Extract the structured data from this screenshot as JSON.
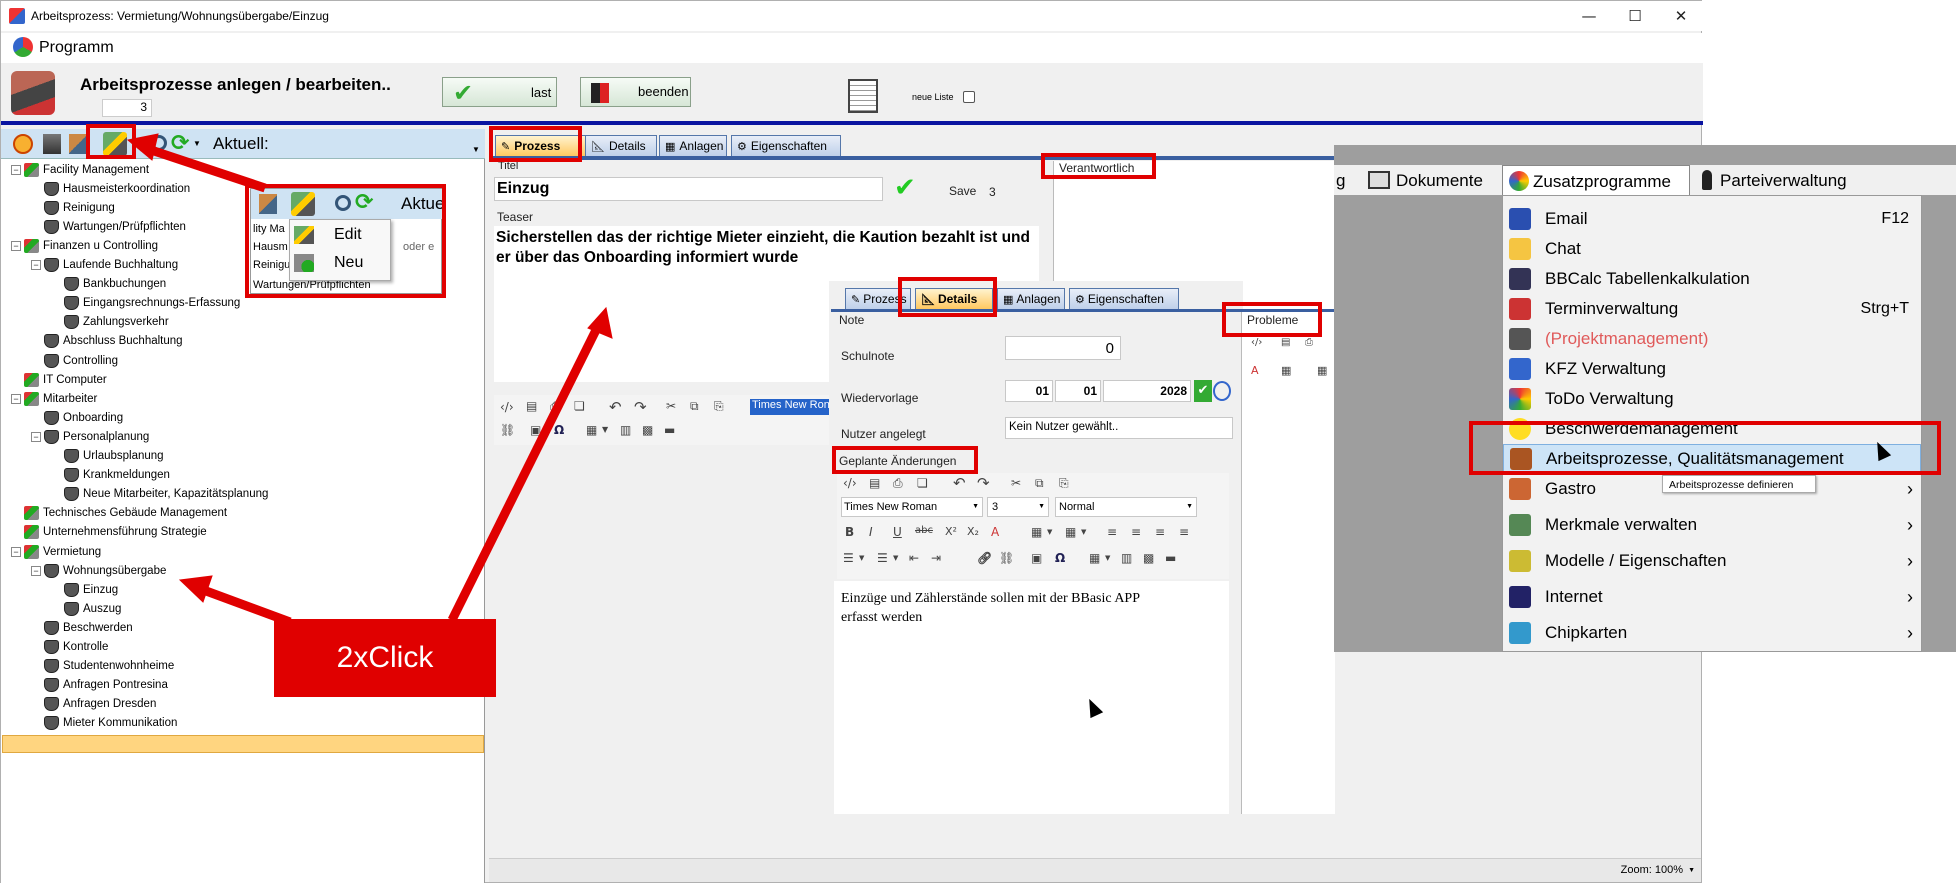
{
  "window": {
    "title": "Arbeitsprozess: Vermietung/Wohnungsübergabe/Einzug",
    "menu_program": "Programm",
    "controls": {
      "minimize": "—",
      "maximize": "☐",
      "close": "✕"
    }
  },
  "header": {
    "heading": "Arbeitsprozesse anlegen / bearbeiten..",
    "count": "3",
    "last_button": "last",
    "end_button": "beenden",
    "new_list_label": "neue Liste"
  },
  "left_toolbar": {
    "aktuell_label": "Aktuell:"
  },
  "popup": {
    "aktuell_label": "Aktue",
    "menu_items": [
      "Edit",
      "Neu"
    ],
    "bg_rows": [
      "lity Ma",
      "Hausm",
      "Reinigu",
      "Wartungen/Prüfpflichten"
    ],
    "bg_input": "oder e"
  },
  "tree": {
    "items": [
      {
        "label": "Facility Management",
        "indent": 0,
        "kind": "folder",
        "expander": "−"
      },
      {
        "label": "Hausmeisterkoordination",
        "indent": 1,
        "kind": "shield",
        "expander": ""
      },
      {
        "label": "Reinigung",
        "indent": 1,
        "kind": "shield",
        "expander": ""
      },
      {
        "label": "Wartungen/Prüfpflichten",
        "indent": 1,
        "kind": "shield",
        "expander": ""
      },
      {
        "label": "Finanzen u Controlling",
        "indent": 0,
        "kind": "folder",
        "expander": "−"
      },
      {
        "label": "Laufende Buchhaltung",
        "indent": 1,
        "kind": "shield",
        "expander": "−"
      },
      {
        "label": "Bankbuchungen",
        "indent": 2,
        "kind": "shield",
        "expander": ""
      },
      {
        "label": "Eingangsrechnungs-Erfassung",
        "indent": 2,
        "kind": "shield",
        "expander": ""
      },
      {
        "label": "Zahlungsverkehr",
        "indent": 2,
        "kind": "shield",
        "expander": ""
      },
      {
        "label": "Abschluss Buchhaltung",
        "indent": 1,
        "kind": "shield",
        "expander": ""
      },
      {
        "label": "Controlling",
        "indent": 1,
        "kind": "shield",
        "expander": ""
      },
      {
        "label": "IT Computer",
        "indent": 0,
        "kind": "folder",
        "expander": ""
      },
      {
        "label": "Mitarbeiter",
        "indent": 0,
        "kind": "folder",
        "expander": "−"
      },
      {
        "label": "Onboarding",
        "indent": 1,
        "kind": "shield",
        "expander": ""
      },
      {
        "label": "Personalplanung",
        "indent": 1,
        "kind": "shield",
        "expander": "−"
      },
      {
        "label": "Urlaubsplanung",
        "indent": 2,
        "kind": "shield",
        "expander": ""
      },
      {
        "label": "Krankmeldungen",
        "indent": 2,
        "kind": "shield",
        "expander": ""
      },
      {
        "label": "Neue Mitarbeiter, Kapazitätsplanung",
        "indent": 2,
        "kind": "shield",
        "expander": ""
      },
      {
        "label": "Technisches Gebäude Management",
        "indent": 0,
        "kind": "folder",
        "expander": ""
      },
      {
        "label": "Unternehmensführung Strategie",
        "indent": 0,
        "kind": "folder",
        "expander": ""
      },
      {
        "label": "Vermietung",
        "indent": 0,
        "kind": "folder",
        "expander": "−"
      },
      {
        "label": "Wohnungsübergabe",
        "indent": 1,
        "kind": "shield",
        "expander": "−"
      },
      {
        "label": "Einzug",
        "indent": 2,
        "kind": "shield",
        "expander": ""
      },
      {
        "label": "Auszug",
        "indent": 2,
        "kind": "shield",
        "expander": ""
      },
      {
        "label": "Beschwerden",
        "indent": 1,
        "kind": "shield",
        "expander": ""
      },
      {
        "label": "Kontrolle",
        "indent": 1,
        "kind": "shield",
        "expander": ""
      },
      {
        "label": "Studentenwohnheime",
        "indent": 1,
        "kind": "shield",
        "expander": ""
      },
      {
        "label": "Anfragen Pontresina",
        "indent": 1,
        "kind": "shield",
        "expander": ""
      },
      {
        "label": "Anfragen Dresden",
        "indent": 1,
        "kind": "shield",
        "expander": ""
      },
      {
        "label": "Mieter Kommunikation",
        "indent": 1,
        "kind": "shield",
        "expander": ""
      }
    ]
  },
  "callout": {
    "text": "2xClick"
  },
  "main_tabs": [
    "Prozess",
    "Details",
    "Anlagen",
    "Eigenschaften"
  ],
  "prozess": {
    "title_label": "Titel",
    "title_value": "Einzug",
    "save_label": "Save",
    "save_count": "3",
    "teaser_label": "Teaser",
    "teaser_value": "Sicherstellen das der richtige Mieter einzieht, die Kaution bezahlt ist und er über das Onboarding informiert wurde",
    "verantwortlich_label": "Verantwortlich",
    "font_value": "Times New Ron"
  },
  "details": {
    "tabs": [
      "Prozess",
      "Details",
      "Anlagen",
      "Eigenschaften"
    ],
    "note_label": "Note",
    "probleme_label": "Probleme",
    "schulnote_label": "Schulnote",
    "schulnote_value": "0",
    "wiedervorlage_label": "Wiedervorlage",
    "date_day": "01",
    "date_month": "01",
    "date_year": "2028",
    "nutzer_label": "Nutzer angelegt",
    "nutzer_value": "Kein Nutzer gewählt..",
    "geplant_label": "Geplante Änderungen",
    "font_family": "Times New Roman",
    "font_size": "3",
    "font_style": "Normal",
    "editor_text": "Einzüge und Zählerstände sollen mit der BBasic APP erfasst werden"
  },
  "status": {
    "zoom": "Zoom: 100%"
  },
  "zusatz": {
    "menubar": [
      {
        "label": "g"
      },
      {
        "label": "Dokumente"
      },
      {
        "label": "Zusatzprogramme"
      },
      {
        "label": "Parteiverwaltung"
      }
    ],
    "items": [
      {
        "label": "Email",
        "shortcut": "F12",
        "arrow": "",
        "color": "#000000"
      },
      {
        "label": "Chat",
        "shortcut": "",
        "arrow": "",
        "color": "#000000"
      },
      {
        "label": "BBCalc Tabellenkalkulation",
        "shortcut": "",
        "arrow": "",
        "color": "#000000"
      },
      {
        "label": "Terminverwaltung",
        "shortcut": "Strg+T",
        "arrow": "",
        "color": "#000000"
      },
      {
        "label": "(Projektmanagement)",
        "shortcut": "",
        "arrow": "",
        "color": "#e05a5a"
      },
      {
        "label": "KFZ Verwaltung",
        "shortcut": "",
        "arrow": "",
        "color": "#000000"
      },
      {
        "label": "ToDo Verwaltung",
        "shortcut": "",
        "arrow": "",
        "color": "#000000"
      },
      {
        "label": "Beschwerdemanagement",
        "shortcut": "",
        "arrow": "",
        "color": "#000000"
      },
      {
        "label": "Arbeitsprozesse, Qualitätsmanagement",
        "shortcut": "",
        "arrow": "",
        "color": "#000000"
      },
      {
        "label": "Gastro",
        "shortcut": "",
        "arrow": "›",
        "color": "#000000"
      },
      {
        "label": "Merkmale verwalten",
        "shortcut": "",
        "arrow": "›",
        "color": "#000000"
      },
      {
        "label": "Modelle / Eigenschaften",
        "shortcut": "",
        "arrow": "›",
        "color": "#000000"
      },
      {
        "label": "Internet",
        "shortcut": "",
        "arrow": "›",
        "color": "#000000"
      },
      {
        "label": "Chipkarten",
        "shortcut": "",
        "arrow": "›",
        "color": "#000000"
      }
    ],
    "tooltip": "Arbeitsprozesse definieren"
  },
  "colors": {
    "accent_red": "#e00000",
    "highlight": "#ffd580",
    "menu_hover": "#cde4f7",
    "brand_blue": "#0a14a0"
  }
}
